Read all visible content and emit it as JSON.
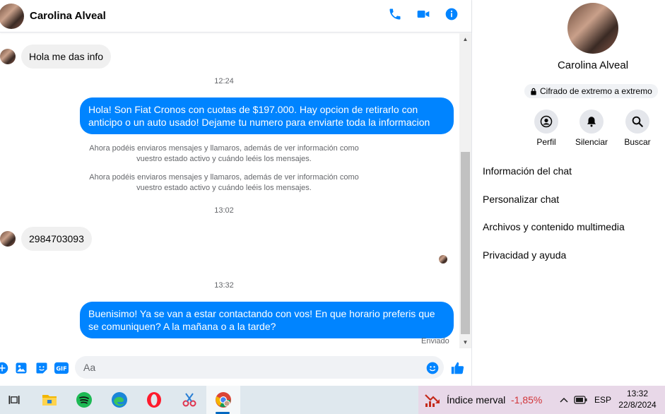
{
  "header": {
    "contact_name": "Carolina Alveal"
  },
  "messages": {
    "m1": "Hola  me das info",
    "t1": "12:24",
    "m2": "Hola! Son Fiat Cronos con cuotas de $197.000. Hay opcion de retirarlo con anticipo o un auto usado! Dejame tu numero para enviarte toda la informacion",
    "s1": "Ahora podéis enviaros mensajes y llamaros, además de ver información como vuestro estado activo y cuándo leéis los mensajes.",
    "s2": "Ahora podéis enviaros mensajes y llamaros, además de ver información como vuestro estado activo y cuándo leéis los mensajes.",
    "t2": "13:02",
    "m3": "2984703093",
    "t3": "13:32",
    "m4": "Buenisimo! Ya se van a estar contactando con vos! En que horario preferis que se comuniquen? A la mañana o a la tarde?",
    "status": "Enviado"
  },
  "composer": {
    "placeholder": "Aa"
  },
  "sidebar": {
    "name": "Carolina Alveal",
    "encryption": "Cifrado de extremo a extremo",
    "actions": {
      "profile": "Perfil",
      "mute": "Silenciar",
      "search": "Buscar"
    },
    "menu": {
      "info": "Información del chat",
      "customize": "Personalizar chat",
      "files": "Archivos y contenido multimedia",
      "privacy": "Privacidad y ayuda"
    }
  },
  "taskbar": {
    "widget_title": "Índice merval",
    "widget_value": "-1,85%",
    "language": "ESP",
    "time": "13:32",
    "date": "22/8/2024"
  },
  "colors": {
    "accent": "#0084ff",
    "negative": "#d13438"
  }
}
